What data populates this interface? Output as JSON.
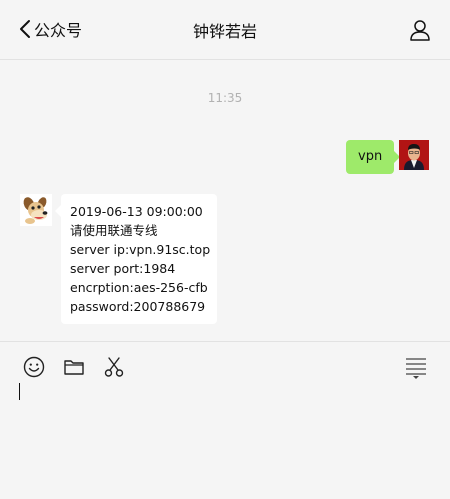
{
  "header": {
    "back_label": "公众号",
    "title": "钟铧若岩"
  },
  "chat": {
    "timestamp": "11:35",
    "messages": [
      {
        "sender": "me",
        "text": "vpn"
      },
      {
        "sender": "contact",
        "lines": [
          "2019-06-13 09:00:00",
          "请使用联通专线",
          "server ip:vpn.91sc.top",
          "server port:1984",
          "encrption:aes-256-cfb",
          "password:200788679"
        ]
      }
    ]
  },
  "input": {
    "value": "",
    "tools": [
      "emoji-icon",
      "folder-icon",
      "scissors-icon",
      "chat-history-icon"
    ]
  },
  "colors": {
    "background": "#f5f5f5",
    "bubble_sent": "#9eea6a",
    "bubble_received": "#ffffff",
    "timestamp": "#b2b2b2"
  }
}
